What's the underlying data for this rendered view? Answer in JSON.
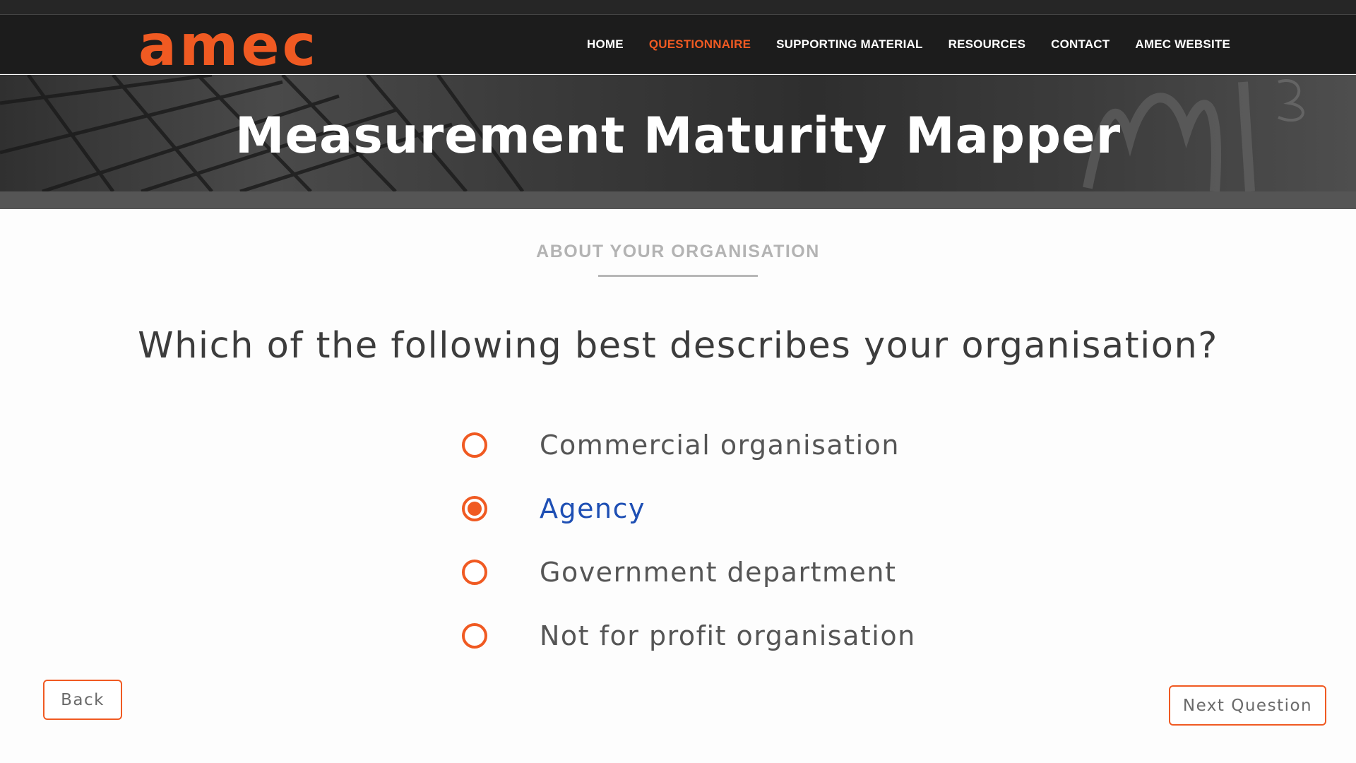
{
  "brand": {
    "logo_text": "amec",
    "accent": "#f05a22",
    "link_selected": "#1e4fb4"
  },
  "nav": {
    "items": [
      {
        "label": "HOME",
        "active": false
      },
      {
        "label": "QUESTIONNAIRE",
        "active": true
      },
      {
        "label": "SUPPORTING MATERIAL",
        "active": false
      },
      {
        "label": "RESOURCES",
        "active": false
      },
      {
        "label": "CONTACT",
        "active": false
      },
      {
        "label": "AMEC WEBSITE",
        "active": false
      }
    ]
  },
  "hero": {
    "title": "Measurement Maturity Mapper"
  },
  "section": {
    "label": "ABOUT YOUR ORGANISATION"
  },
  "question": {
    "text": "Which of the following best describes your organisation?",
    "options": [
      {
        "label": "Commercial organisation",
        "selected": false
      },
      {
        "label": "Agency",
        "selected": true
      },
      {
        "label": "Government department",
        "selected": false
      },
      {
        "label": "Not for profit organisation",
        "selected": false
      }
    ]
  },
  "buttons": {
    "back_label": "Back",
    "next_label": "Next Question"
  }
}
